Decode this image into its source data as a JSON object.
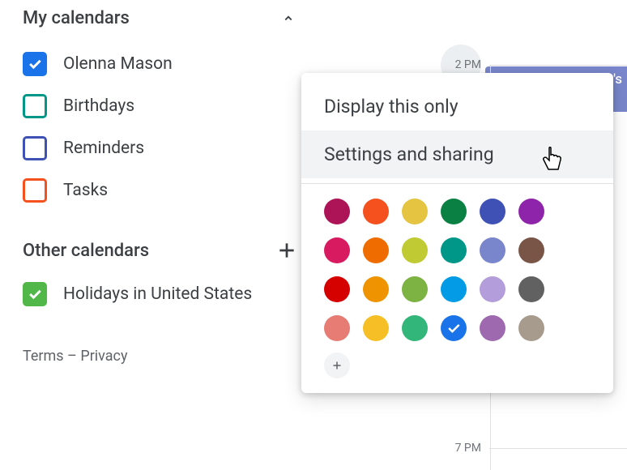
{
  "sidebar": {
    "my_calendars_title": "My calendars",
    "other_calendars_title": "Other calendars",
    "items": [
      {
        "label": "Olenna Mason",
        "color": "#1a73e8",
        "checked": true
      },
      {
        "label": "Birthdays",
        "color": "#009688",
        "checked": false
      },
      {
        "label": "Reminders",
        "color": "#3f51b5",
        "checked": false
      },
      {
        "label": "Tasks",
        "color": "#f4511e",
        "checked": false
      }
    ],
    "other_items": [
      {
        "label": "Holidays in United States",
        "color": "#51b749",
        "checked": true
      }
    ]
  },
  "footer": {
    "terms": "Terms",
    "separator": " – ",
    "privacy": "Privacy"
  },
  "grid": {
    "time_2pm": "2 PM",
    "time_7pm": "7 PM",
    "event_text": "'s"
  },
  "menu": {
    "display_only": "Display this only",
    "settings_sharing": "Settings and sharing",
    "colors": [
      {
        "hex": "#ad1457",
        "selected": false
      },
      {
        "hex": "#f4511e",
        "selected": false
      },
      {
        "hex": "#e4c441",
        "selected": false
      },
      {
        "hex": "#0b8043",
        "selected": false
      },
      {
        "hex": "#3f51b5",
        "selected": false
      },
      {
        "hex": "#8e24aa",
        "selected": false
      },
      {
        "hex": "#d81b60",
        "selected": false
      },
      {
        "hex": "#ef6c00",
        "selected": false
      },
      {
        "hex": "#c0ca33",
        "selected": false
      },
      {
        "hex": "#009688",
        "selected": false
      },
      {
        "hex": "#7986cb",
        "selected": false
      },
      {
        "hex": "#795548",
        "selected": false
      },
      {
        "hex": "#d50000",
        "selected": false
      },
      {
        "hex": "#f09300",
        "selected": false
      },
      {
        "hex": "#7cb342",
        "selected": false
      },
      {
        "hex": "#039be5",
        "selected": false
      },
      {
        "hex": "#b39ddb",
        "selected": false
      },
      {
        "hex": "#616161",
        "selected": false
      },
      {
        "hex": "#e67c73",
        "selected": false
      },
      {
        "hex": "#f6bf26",
        "selected": false
      },
      {
        "hex": "#33b679",
        "selected": false
      },
      {
        "hex": "#1a73e8",
        "selected": true
      },
      {
        "hex": "#9e69af",
        "selected": false
      },
      {
        "hex": "#a79b8e",
        "selected": false
      }
    ]
  }
}
